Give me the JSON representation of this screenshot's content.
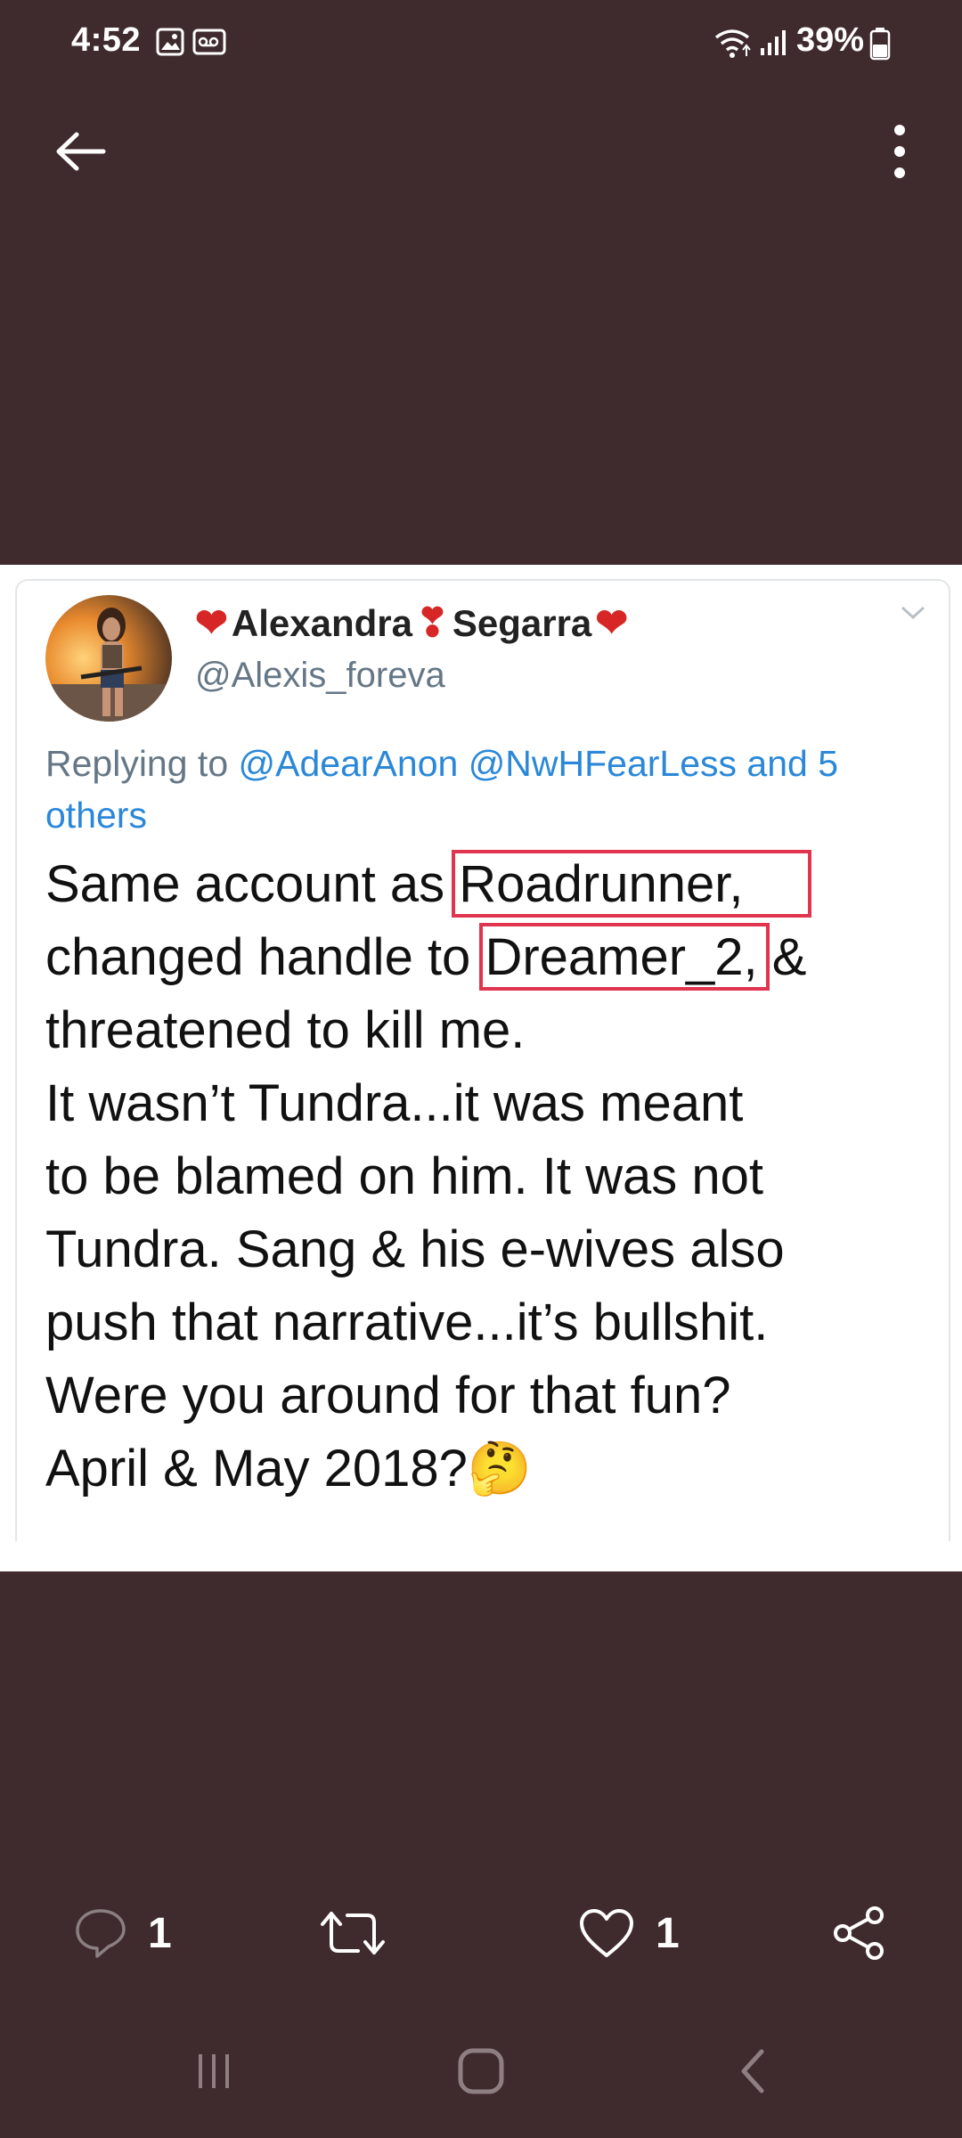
{
  "status_bar": {
    "time": "4:52",
    "battery": "39%",
    "icons": [
      "gallery-icon",
      "voicemail-icon",
      "wifi-icon",
      "signal-icon",
      "battery-icon"
    ]
  },
  "app_bar": {
    "back_icon": "arrow-left-icon",
    "more_icon": "more-vertical-icon"
  },
  "tweet": {
    "display_name_parts": [
      "Alexandra",
      "Segarra"
    ],
    "handle": "@Alexis_foreva",
    "replying_prefix": "Replying to ",
    "replying_to": "@AdearAnon @NwHFearLess and 5 others",
    "line1_a": "Same account as ",
    "line1_hl": "Roadrunner,",
    "line2_a": "changed handle to ",
    "line2_hl": "Dreamer_2,",
    "line2_b": " &",
    "line3": "threatened to kill me.",
    "line4": "It wasn’t Tundra...it was meant",
    "line5": "to be blamed on him. It was not",
    "line6": "Tundra. Sang & his e-wives also",
    "line7": "push that narrative...it’s bullshit.",
    "line8": "Were you around for that fun?",
    "line9": "April & May 2018?",
    "emoji": "🤔",
    "colors": {
      "link": "#2b88d8",
      "highlight_box": "#e0344f",
      "heart": "#d62626"
    }
  },
  "actions": {
    "reply_count": "1",
    "like_count": "1"
  },
  "colors": {
    "background": "#3f2b2e"
  }
}
